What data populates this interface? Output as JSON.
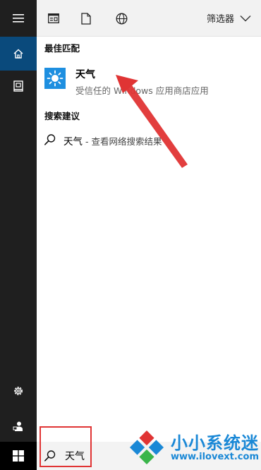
{
  "sidebar": {
    "items": [
      {
        "icon": "hamburger-menu-icon"
      },
      {
        "icon": "home-icon",
        "active": true
      },
      {
        "icon": "notebook-icon"
      },
      {
        "icon": "settings-icon"
      },
      {
        "icon": "feedback-icon"
      }
    ]
  },
  "toolbar": {
    "icons": [
      "apps-icon",
      "documents-icon",
      "web-icon"
    ],
    "filter_label": "筛选器"
  },
  "best_match": {
    "heading": "最佳匹配",
    "app_name": "天气",
    "app_desc": "受信任的 Windows 应用商店应用",
    "icon": "weather-sun-icon",
    "icon_color": "#1e8fe0"
  },
  "suggestions": {
    "heading": "搜索建议",
    "items": [
      {
        "query": "天气",
        "suffix": " - 查看网络搜索结果"
      }
    ]
  },
  "taskbar": {
    "search_value": "天气"
  },
  "colors": {
    "rail_bg": "#1f1f1f",
    "rail_active": "#0a4a7c",
    "annotation": "#e03434",
    "watermark": "#1a88d6"
  },
  "watermark": {
    "title": "小小系统迷",
    "url": "www.ilovext.com"
  }
}
